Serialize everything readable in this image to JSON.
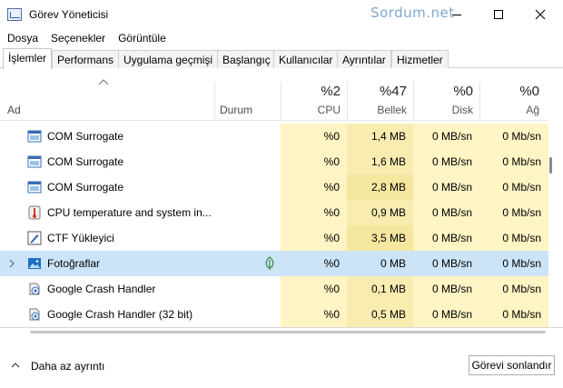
{
  "window": {
    "title": "Görev Yöneticisi",
    "watermark": "Sordum.net"
  },
  "menu": [
    "Dosya",
    "Seçenekler",
    "Görüntüle"
  ],
  "tabs": [
    "İşlemler",
    "Performans",
    "Uygulama geçmişi",
    "Başlangıç",
    "Kullanıcılar",
    "Ayrıntılar",
    "Hizmetler"
  ],
  "columns": {
    "name": "Ad",
    "status": "Durum",
    "cpu": {
      "pct": "%2",
      "label": "CPU"
    },
    "memory": {
      "pct": "%47",
      "label": "Bellek"
    },
    "disk": {
      "pct": "%0",
      "label": "Disk"
    },
    "network": {
      "pct": "%0",
      "label": "Ağ"
    }
  },
  "rows": [
    {
      "name": "COM Surrogate",
      "cpu": "%0",
      "memory": "1,4 MB",
      "disk": "0 MB/sn",
      "network": "0 Mb/sn",
      "icon": "window-icon"
    },
    {
      "name": "COM Surrogate",
      "cpu": "%0",
      "memory": "1,6 MB",
      "disk": "0 MB/sn",
      "network": "0 Mb/sn",
      "icon": "window-icon"
    },
    {
      "name": "COM Surrogate",
      "cpu": "%0",
      "memory": "2,8 MB",
      "disk": "0 MB/sn",
      "network": "0 Mb/sn",
      "icon": "window-icon"
    },
    {
      "name": "CPU temperature and system in...",
      "cpu": "%0",
      "memory": "0,9 MB",
      "disk": "0 MB/sn",
      "network": "0 Mb/sn",
      "icon": "thermometer-icon"
    },
    {
      "name": "CTF Yükleyici",
      "cpu": "%0",
      "memory": "3,5 MB",
      "disk": "0 MB/sn",
      "network": "0 Mb/sn",
      "icon": "pen-icon"
    },
    {
      "name": "Fotoğraflar",
      "cpu": "%0",
      "memory": "0 MB",
      "disk": "0 MB/sn",
      "network": "0 Mb/sn",
      "icon": "photos-icon",
      "selected": true,
      "expandable": true,
      "status_icon": "leaf-icon"
    },
    {
      "name": "Google Crash Handler",
      "cpu": "%0",
      "memory": "0,1 MB",
      "disk": "0 MB/sn",
      "network": "0 Mb/sn",
      "icon": "crash-handler-icon"
    },
    {
      "name": "Google Crash Handler (32 bit)",
      "cpu": "%0",
      "memory": "0,5 MB",
      "disk": "0 MB/sn",
      "network": "0 Mb/sn",
      "icon": "crash-handler-icon"
    }
  ],
  "footer": {
    "less_details": "Daha az ayrıntı",
    "end_task": "Görevi sonlandır"
  },
  "colors": {
    "heat_light": "#fff4c4",
    "heat_mid": "#f9ecb0",
    "selection": "#cce4f7",
    "watermark": "#7fa6cf"
  }
}
